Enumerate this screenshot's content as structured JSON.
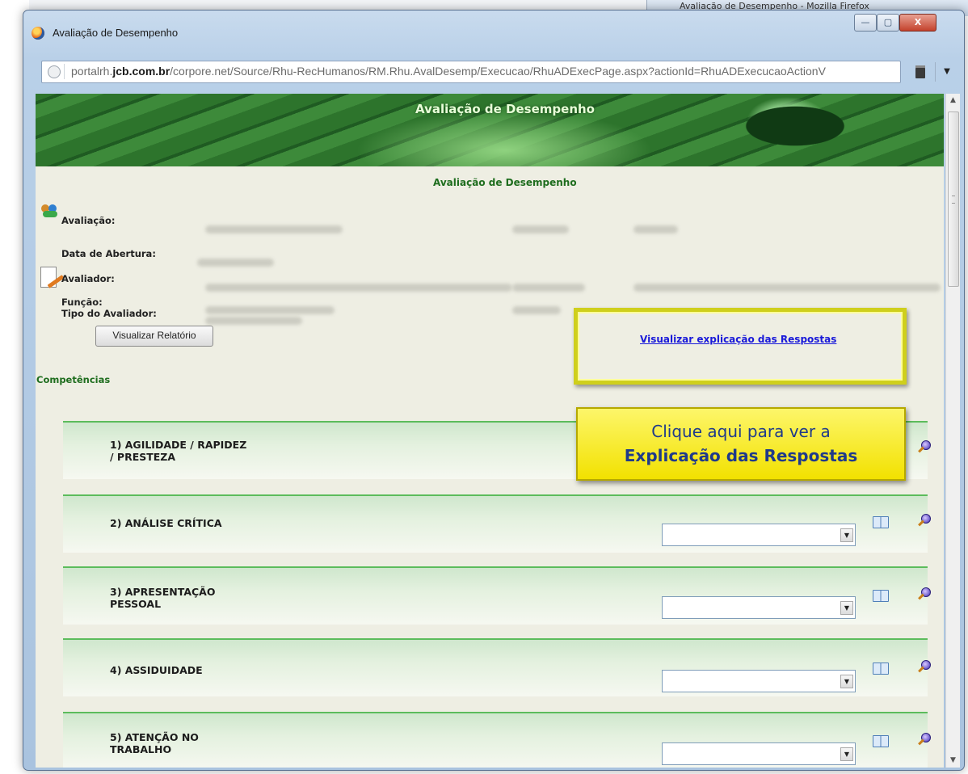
{
  "taskbar": {
    "title": "Avaliação de Desempenho - Mozilla Firefox"
  },
  "window": {
    "title": "Avaliação de Desempenho",
    "controls": {
      "minimize": "—",
      "maximize": "▢",
      "close": "X"
    }
  },
  "urlbar": {
    "url_prefix": "portalrh.",
    "url_domain": "jcb.com.br",
    "url_rest": "/corpore.net/Source/Rhu-RecHumanos/RM.Rhu.AvalDesemp/Execucao/RhuADExecPage.aspx?actionId=RhuADExecucaoActionV"
  },
  "page": {
    "banner_title": "Avaliação de Desempenho",
    "subtitle": "Avaliação de Desempenho",
    "fields": {
      "avaliacao": "Avaliação:",
      "data_abertura": "Data de Abertura:",
      "avaliador": "Avaliador:",
      "funcao": "Função:",
      "tipo_avaliador": "Tipo do Avaliador:"
    },
    "report_button": "Visualizar Relatório",
    "competencias_label": "Competências",
    "explain_link": "Visualizar explicação das Respostas",
    "callout": {
      "line1": "Clique aqui para ver a",
      "line2": "Explicação das Respostas"
    },
    "competencies": [
      {
        "name": "1) AGILIDADE / RAPIDEZ\n/ PRESTEZA",
        "selected": ""
      },
      {
        "name": "2) ANÁLISE CRÍTICA",
        "selected": ""
      },
      {
        "name": "3) APRESENTAÇÃO\nPESSOAL",
        "selected": ""
      },
      {
        "name": "4) ASSIDUIDADE",
        "selected": ""
      },
      {
        "name": "5) ATENÇÃO NO\nTRABALHO",
        "selected": ""
      }
    ]
  },
  "icons": {
    "window": "firefox-icon",
    "url": "globe-icon",
    "people": "people-icon",
    "document": "document-pen-icon",
    "dropdown": "chevron-down-icon",
    "book": "book-icon",
    "zoom": "magnifier-icon"
  },
  "colors": {
    "page_bg": "#eeeee3",
    "green_text": "#1e6d1e",
    "link": "#1a1ad9",
    "callout_bg": "#f2e100",
    "callout_text": "#1f3a8a",
    "highlight_border": "#cfcf1c",
    "row_border": "#5cbc5c"
  }
}
